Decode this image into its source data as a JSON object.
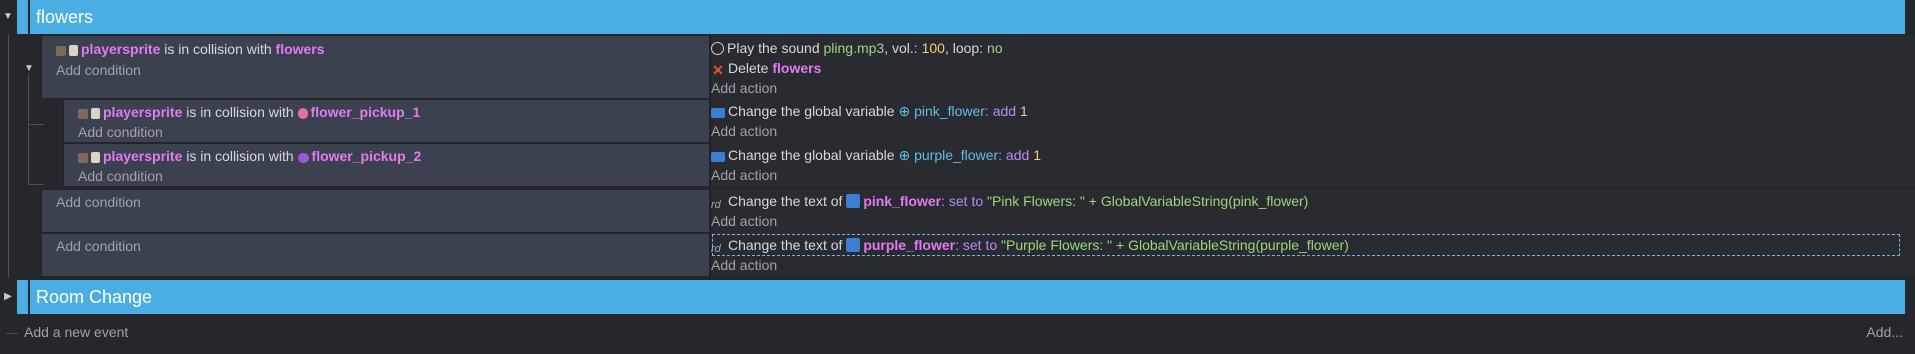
{
  "groups": {
    "flowers": {
      "title": "flowers"
    },
    "room_change": {
      "title": "Room Change"
    }
  },
  "events": {
    "e1": {
      "condition": {
        "object": "playersprite",
        "text": "is in collision with",
        "target": "flowers"
      },
      "add_condition": "Add condition",
      "actions": [
        {
          "icon": "sound-icon",
          "prefix": "Play the sound",
          "file": "pling.mp3",
          "sep1": ", vol.:",
          "vol": "100",
          "sep2": ", loop:",
          "loop": "no"
        },
        {
          "icon": "delete-icon",
          "prefix": "Delete",
          "object": "flowers"
        }
      ],
      "add_action": "Add action"
    },
    "e2": {
      "condition": {
        "object": "playersprite",
        "text": "is in collision with",
        "target": "flower_pickup_1"
      },
      "add_condition": "Add condition",
      "action": {
        "prefix": "Change the global variable",
        "var": "pink_flower",
        "op": ": add",
        "val": "1"
      },
      "add_action": "Add action"
    },
    "e3": {
      "condition": {
        "object": "playersprite",
        "text": "is in collision with",
        "target": "flower_pickup_2"
      },
      "add_condition": "Add condition",
      "action": {
        "prefix": "Change the global variable",
        "var": "purple_flower",
        "op": ": add",
        "val": "1"
      },
      "add_action": "Add action"
    },
    "e4": {
      "add_condition": "Add condition",
      "action": {
        "prefix": "Change the text of",
        "object": "pink_flower",
        "op": ": set to",
        "val": "\"Pink Flowers: \" + GlobalVariableString(pink_flower)"
      },
      "add_action": "Add action"
    },
    "e5": {
      "add_condition": "Add condition",
      "action": {
        "prefix": "Change the text of",
        "object": "purple_flower",
        "op": ": set to",
        "val": "\"Purple Flowers: \" + GlobalVariableString(purple_flower)"
      },
      "add_action": "Add action"
    }
  },
  "footer": {
    "add_event": "Add a new event",
    "add": "Add..."
  },
  "colors": {
    "group": "#4aaee3",
    "object": "#e07bf0",
    "number": "#f2cf7a",
    "string": "#9bd67d",
    "keyword": "#b68cf5",
    "variable": "#5fbde3"
  }
}
